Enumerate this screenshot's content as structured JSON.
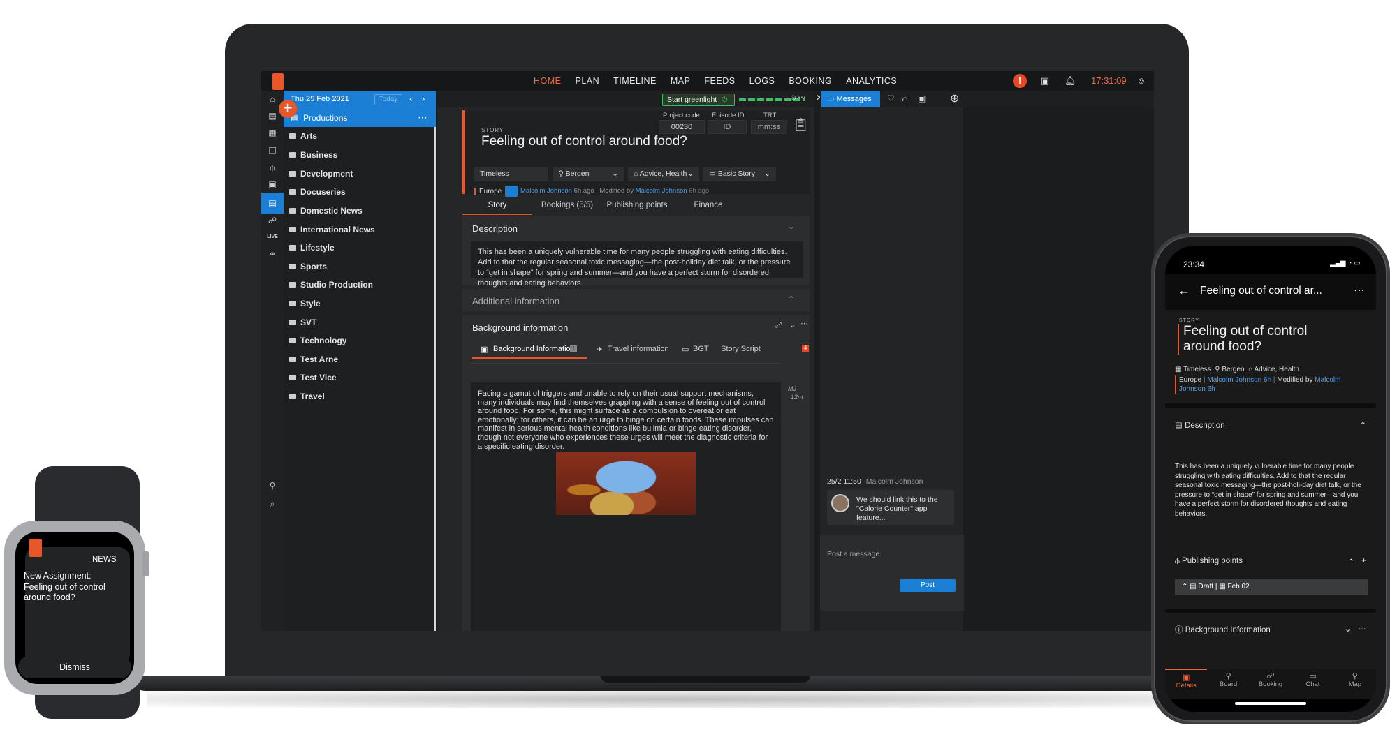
{
  "desktop": {
    "nav": [
      "HOME",
      "PLAN",
      "TIMELINE",
      "MAP",
      "FEEDS",
      "LOGS",
      "BOOKING",
      "ANALYTICS"
    ],
    "clock": "17:31:09",
    "alert": "!",
    "date": "Thu 25 Feb 2021",
    "today": "Today",
    "productions": "Productions",
    "folders": [
      "Arts",
      "Business",
      "Development",
      "Docuseries",
      "Domestic News",
      "International News",
      "Lifestyle",
      "Sports",
      "Studio Production",
      "Style",
      "SVT",
      "Technology",
      "Test Arne",
      "Test Vice",
      "Travel"
    ],
    "rail_live": "LIVE",
    "greenlight": "Start greenlight",
    "story": {
      "kicker": "STORY",
      "title": "Feeling out of control around food?",
      "project_code_label": "Project code",
      "project_code": "00230",
      "episode_label": "Episode ID",
      "episode_placeholder": "ID",
      "trt_label": "TRT",
      "trt_placeholder": "mm:ss",
      "tags": [
        "Timeless",
        "Bergen",
        "Advice, Health",
        "Basic Story"
      ],
      "region": "Europe",
      "author": "Malcolm Johnson",
      "created_ago": "6h ago | Modified by",
      "modified_by": "Malcolm Johnson",
      "modified_ago": "6h ago"
    },
    "tabs": [
      "Story",
      "Bookings (5/5)",
      "Publishing points",
      "Finance"
    ],
    "description": {
      "title": "Description",
      "text": "This has been a uniquely vulnerable time for many people struggling with eating difficulties. Add to that the regular seasonal toxic messaging—the post-holiday diet talk, or the pressure to “get in shape” for spring and summer—and you have a perfect storm for disordered thoughts and eating behaviors."
    },
    "additional_info": "Additional information",
    "background": {
      "title": "Background information",
      "subtabs": [
        "Background Information",
        "Travel information",
        "BGT",
        "Story Script"
      ],
      "badge_1": "1",
      "badge_4": "4",
      "text": "Facing a gamut of triggers and unable to rely on their usual support mechanisms, many individuals may find themselves grappling with a sense of feeling out of control around food. For some, this might surface as a compulsion to overeat or eat emotionally; for others, it can be an urge to binge on certain foods. These impulses can manifest in serious mental health conditions like bulimia or binge eating disorder, though not everyone who experiences these urges will meet the diagnostic criteria for a specific eating disorder.",
      "editor_initials": "MJ",
      "editor_ago": "12m"
    },
    "messages": {
      "tab": "Messages",
      "meta_time": "25/2 11:50",
      "meta_author": "Malcolm Johnson",
      "text": "We should link this to the \"Calorie Counter\" app feature...",
      "placeholder": "Post a message",
      "post": "Post"
    }
  },
  "phone": {
    "time": "23:34",
    "header_title": "Feeling out of control ar...",
    "kicker": "STORY",
    "title": "Feeling out of control around food?",
    "tag_line": "Timeless",
    "tag_bergen": "Bergen",
    "tag_advice": "Advice, Health",
    "region": "Europe",
    "author": "Malcolm Johnson 6h",
    "modified_label": "Modified by",
    "modified_by": "Malcolm Johnson 6h",
    "description_title": "Description",
    "description_text": "This has been a uniquely vulnerable time for many people struggling with eating difficulties. Add to that the regular seasonal toxic messaging—the post-holi-day diet talk, or the pressure to “get in shape” for spring and summer—and you have a perfect storm for disordered thoughts and eating behaviors.",
    "publishing_title": "Publishing points",
    "draft": "Draft | ▦ Feb 02",
    "background_title": "Background Information",
    "tabs": [
      "Details",
      "Board",
      "Booking",
      "Chat",
      "Map"
    ]
  },
  "watch": {
    "tag": "NEWS",
    "text": "New Assignment: Feeling out of control around food?",
    "dismiss": "Dismiss"
  }
}
